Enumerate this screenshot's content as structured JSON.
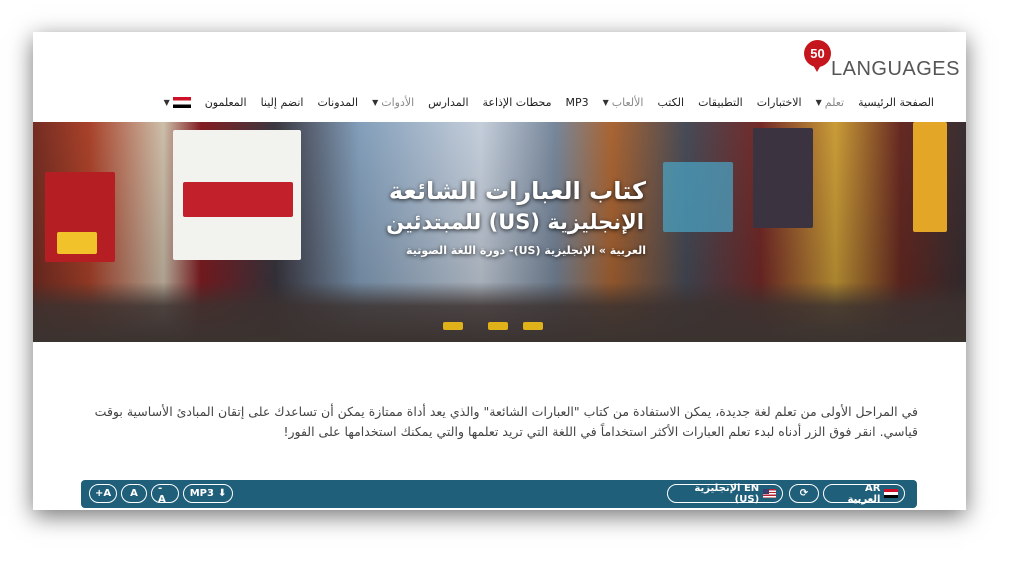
{
  "logo": {
    "number": "50",
    "word": "LANGUAGES"
  },
  "nav": {
    "items": [
      {
        "label": "الصفحة الرئيسية"
      },
      {
        "label": "تعلم",
        "dropdown": true
      },
      {
        "label": "الاختبارات"
      },
      {
        "label": "التطبيقات"
      },
      {
        "label": "الكتب"
      },
      {
        "label": "الألعاب",
        "dropdown": true
      },
      {
        "label": "MP3"
      },
      {
        "label": "محطات الإذاعة"
      },
      {
        "label": "المدارس"
      },
      {
        "label": "الأدوات",
        "dropdown": true
      },
      {
        "label": "المدونات"
      },
      {
        "label": "انضم إلينا"
      },
      {
        "label": "المعلمون"
      }
    ],
    "language_flag": "egypt-flag-icon"
  },
  "hero": {
    "title": "كتاب العبارات الشائعة",
    "subtitle": "الإنجليزية (US) للمبتدئين",
    "breadcrumb": "العربية » الإنجليزية (US)- دورة اللغة الصوتية"
  },
  "intro": {
    "line1": "في المراحل الأولى من تعلم لغة جديدة، يمكن الاستفادة من كتاب \"العبارات الشائعة\" والذي يعد أداة ممتازة يمكن أن تساعدك على إتقان المبادئ الأساسية بوقت",
    "line2": "قياسي. انقر فوق الزر أدناه لبدء تعلم العبارات الأكثر استخداماً في اللغة التي تريد تعلمها والتي يمكنك استخدامها على الفور!"
  },
  "toolbar": {
    "source_lang": "AR العربية",
    "target_lang": "EN الإنجليزية (US)",
    "swap_icon": "refresh-icon",
    "mp3_label": "MP3",
    "font_minus": "- A",
    "font_normal": "A",
    "font_plus": "+A",
    "bar_color": "#1f5f7a"
  }
}
